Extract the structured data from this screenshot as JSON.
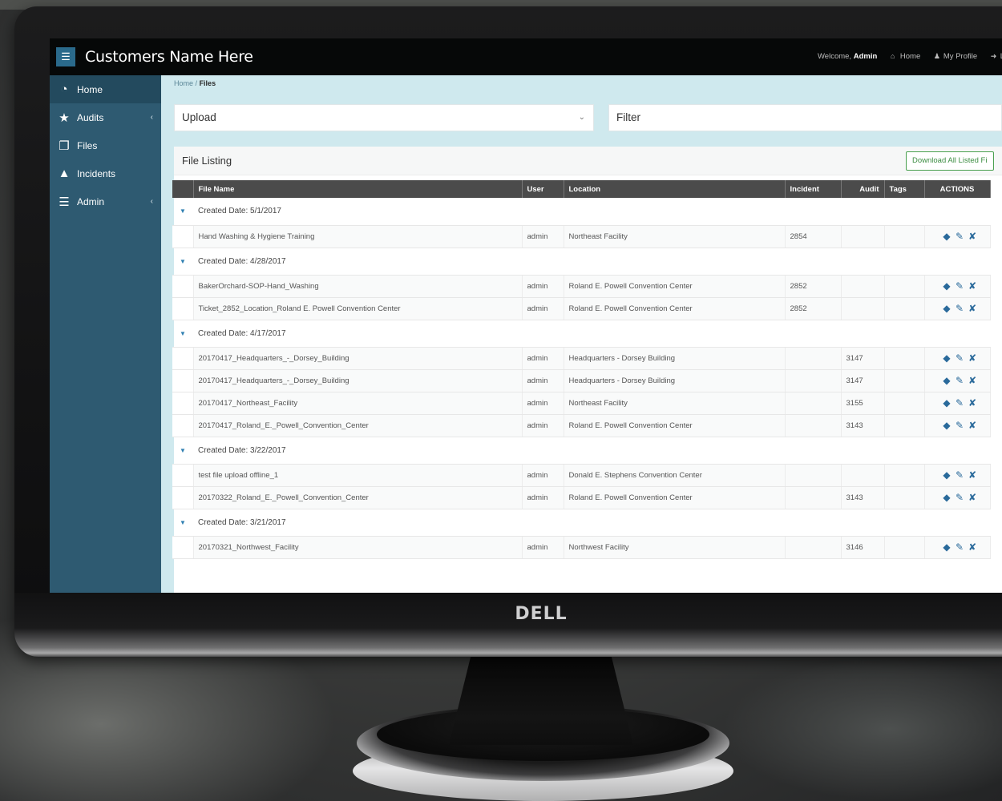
{
  "app": {
    "title": "Customers Name Here",
    "menu_icon": "hamburger-icon",
    "welcome_prefix": "Welcome,",
    "welcome_user": "Admin",
    "top_links": [
      {
        "label": "Home",
        "icon": "home-icon"
      },
      {
        "label": "My Profile",
        "icon": "user-icon"
      },
      {
        "label": "Lo",
        "icon": "logout-icon"
      }
    ]
  },
  "sidebar": {
    "items": [
      {
        "label": "Home",
        "icon": "dashboard-icon",
        "active": true
      },
      {
        "label": "Audits",
        "icon": "star-icon",
        "has_submenu": true
      },
      {
        "label": "Files",
        "icon": "files-icon"
      },
      {
        "label": "Incidents",
        "icon": "warning-icon"
      },
      {
        "label": "Admin",
        "icon": "sliders-icon",
        "has_submenu": true
      }
    ]
  },
  "breadcrumb": {
    "home": "Home",
    "separator": "/",
    "current": "Files"
  },
  "upload": {
    "label": "Upload"
  },
  "filter": {
    "label": "Filter"
  },
  "listing": {
    "title": "File Listing",
    "download_label": "Download All Listed Fi",
    "columns": [
      "File Name",
      "User",
      "Location",
      "Incident",
      "Audit",
      "Tags",
      "ACTIONS"
    ],
    "groups": [
      {
        "label": "Created Date: 5/1/2017",
        "rows": [
          {
            "name": "Hand Washing & Hygiene Training",
            "user": "admin",
            "location": "Northeast Facility",
            "incident": "2854",
            "audit": "",
            "tags": ""
          }
        ]
      },
      {
        "label": "Created Date: 4/28/2017",
        "rows": [
          {
            "name": "BakerOrchard-SOP-Hand_Washing",
            "user": "admin",
            "location": "Roland E. Powell Convention Center",
            "incident": "2852",
            "audit": "",
            "tags": ""
          },
          {
            "name": "Ticket_2852_Location_Roland E. Powell Convention Center",
            "user": "admin",
            "location": "Roland E. Powell Convention Center",
            "incident": "2852",
            "audit": "",
            "tags": ""
          }
        ]
      },
      {
        "label": "Created Date: 4/17/2017",
        "rows": [
          {
            "name": "20170417_Headquarters_-_Dorsey_Building",
            "user": "admin",
            "location": "Headquarters - Dorsey Building",
            "incident": "",
            "audit": "3147",
            "tags": ""
          },
          {
            "name": "20170417_Headquarters_-_Dorsey_Building",
            "user": "admin",
            "location": "Headquarters - Dorsey Building",
            "incident": "",
            "audit": "3147",
            "tags": ""
          },
          {
            "name": "20170417_Northeast_Facility",
            "user": "admin",
            "location": "Northeast Facility",
            "incident": "",
            "audit": "3155",
            "tags": ""
          },
          {
            "name": "20170417_Roland_E._Powell_Convention_Center",
            "user": "admin",
            "location": "Roland E. Powell Convention Center",
            "incident": "",
            "audit": "3143",
            "tags": ""
          }
        ]
      },
      {
        "label": "Created Date: 3/22/2017",
        "rows": [
          {
            "name": "test file upload offline_1",
            "user": "admin",
            "location": "Donald E. Stephens Convention Center",
            "incident": "",
            "audit": "",
            "tags": ""
          },
          {
            "name": "20170322_Roland_E._Powell_Convention_Center",
            "user": "admin",
            "location": "Roland E. Powell Convention Center",
            "incident": "",
            "audit": "3143",
            "tags": ""
          }
        ]
      },
      {
        "label": "Created Date: 3/21/2017",
        "rows": [
          {
            "name": "20170321_Northwest_Facility",
            "user": "admin",
            "location": "Northwest Facility",
            "incident": "",
            "audit": "3146",
            "tags": ""
          }
        ]
      }
    ]
  },
  "monitor": {
    "brand": "DELL"
  },
  "colors": {
    "sidebar": "#2e5a71",
    "topbar": "#060808",
    "content_bg": "#cfe9ee",
    "link": "#3a83b6",
    "download_green": "#49a04f"
  }
}
